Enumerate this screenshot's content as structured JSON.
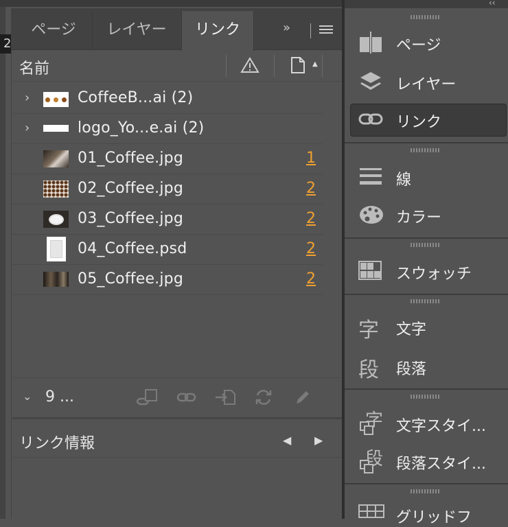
{
  "canvas": {
    "ruler_number": "2"
  },
  "tabs": [
    {
      "label": "ページ",
      "active": false
    },
    {
      "label": "レイヤー",
      "active": false
    },
    {
      "label": "リンク",
      "active": true
    }
  ],
  "tab_bar": {
    "overflow_label": "»",
    "menu_icon": "hamburger-icon"
  },
  "links_panel": {
    "column_name": "名前",
    "header_icons": [
      "warning-icon",
      "page-icon",
      "sort-up-icon"
    ],
    "rows": [
      {
        "name": "CoffeeB...ai (2)",
        "page": "",
        "expandable": true,
        "thumb": "beans-strip"
      },
      {
        "name": "logo_Yo...e.ai (2)",
        "page": "",
        "expandable": true,
        "thumb": "white-bar"
      },
      {
        "name": "01_Coffee.jpg",
        "page": "1",
        "expandable": false,
        "thumb": "dark-photo"
      },
      {
        "name": "02_Coffee.jpg",
        "page": "2",
        "expandable": false,
        "thumb": "beans-photo"
      },
      {
        "name": "03_Coffee.jpg",
        "page": "2",
        "expandable": false,
        "thumb": "cup-photo"
      },
      {
        "name": "04_Coffee.psd",
        "page": "2",
        "expandable": false,
        "thumb": "bag-photo"
      },
      {
        "name": "05_Coffee.jpg",
        "page": "2",
        "expandable": false,
        "thumb": "wide-photo"
      }
    ],
    "summary": {
      "count_label": "9 ..."
    },
    "actions": [
      "relink-from-library-icon",
      "relink-icon",
      "go-to-link-icon",
      "update-link-icon",
      "edit-original-icon"
    ],
    "info": {
      "title": "リンク情報"
    }
  },
  "dock": {
    "items": [
      {
        "label": "ページ",
        "icon": "pages-icon",
        "active": false
      },
      {
        "label": "レイヤー",
        "icon": "layers-icon",
        "active": false
      },
      {
        "label": "リンク",
        "icon": "link-icon",
        "active": true
      },
      {
        "label": "線",
        "icon": "stroke-icon",
        "active": false
      },
      {
        "label": "カラー",
        "icon": "color-palette-icon",
        "active": false
      },
      {
        "label": "スウォッチ",
        "icon": "swatches-icon",
        "active": false
      },
      {
        "label": "文字",
        "icon": "character-icon",
        "active": false
      },
      {
        "label": "段落",
        "icon": "paragraph-icon",
        "active": false
      },
      {
        "label": "文字スタイ...",
        "icon": "character-styles-icon",
        "active": false
      },
      {
        "label": "段落スタイ...",
        "icon": "paragraph-styles-icon",
        "active": false
      },
      {
        "label": "グリッドフ",
        "icon": "grid-format-icon",
        "active": false
      }
    ]
  },
  "colors": {
    "accent_page_number": "#f0a030",
    "panel_bg": "#535353",
    "tab_bar_bg": "#424242"
  }
}
